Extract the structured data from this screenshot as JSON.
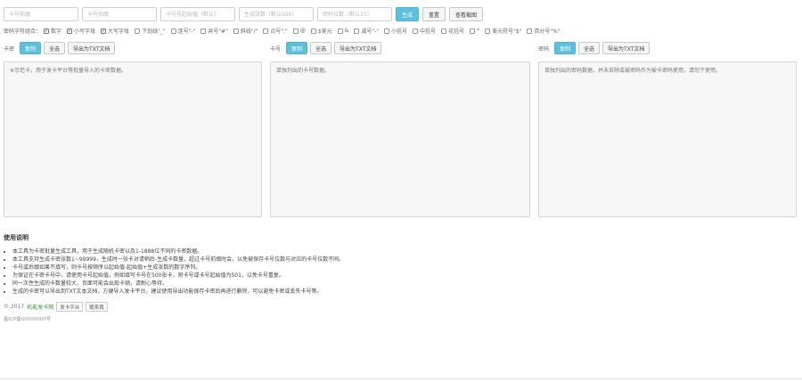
{
  "top": {
    "fields": [
      {
        "placeholder": "卡号前缀"
      },
      {
        "placeholder": "卡号后缀"
      },
      {
        "placeholder": "卡号号起始值（默认）"
      },
      {
        "placeholder": "生成张数（默认500）"
      },
      {
        "placeholder": "密码位数（默认15）"
      }
    ],
    "generate_label": "生成",
    "reset_label": "重置",
    "view_label": "查看截图"
  },
  "charset": {
    "label": "密码字符组合：",
    "options": [
      {
        "label": "数字",
        "checked": true
      },
      {
        "label": "小写字母",
        "checked": true
      },
      {
        "label": "大写字母",
        "checked": true
      },
      {
        "label": "下划线\"_\"",
        "checked": false
      },
      {
        "label": "连号\"-\"",
        "checked": false
      },
      {
        "label": "井号\"#\"",
        "checked": false
      },
      {
        "label": "斜线\"/\"",
        "checked": false
      },
      {
        "label": "点号\".\"",
        "checked": false
      },
      {
        "label": "@",
        "checked": false
      },
      {
        "label": "$美元",
        "checked": false
      },
      {
        "label": "&",
        "checked": false
      },
      {
        "label": "减号\"-\"",
        "checked": false
      },
      {
        "label": "小括号",
        "checked": false
      },
      {
        "label": "中括号",
        "checked": false
      },
      {
        "label": "花括号",
        "checked": false
      },
      {
        "label": "*",
        "checked": false
      },
      {
        "label": "美元符号\"$\"",
        "checked": false
      },
      {
        "label": "百分号\"%\"",
        "checked": false
      }
    ]
  },
  "columns": [
    {
      "title": "卡密",
      "copy": "复制",
      "select_all": "全选",
      "export": "导出为TXT文档",
      "placeholder": "※示范卡，用于发卡平台等批量导入的卡密数据。"
    },
    {
      "title": "卡号",
      "copy": "复制",
      "select_all": "全选",
      "export": "导出为TXT文档",
      "placeholder": "单独列出的卡号数据。"
    },
    {
      "title": "密码",
      "copy": "复制",
      "select_all": "全选",
      "export": "导出为TXT文档",
      "placeholder": "单独列出的密码数据，并未去除或被密码作为被卡密码使用，请勿下使用。"
    }
  ],
  "help": {
    "title": "使用说明",
    "items": [
      "本工具为卡密批量生成工具，用于生成随机卡密以及1-1888位不同的卡密数据。",
      "本工具支持生成卡密张数1~99999，生成时一张卡对请稍后-生成卡数量，超过卡号前缀时会，以免被保存卡号位数与对应的卡号位数不同。",
      "卡号或后缀如果不填写，则卡号按顺序以起始值-起始值+生成张数的数字序列。",
      "为保证在卡密卡号中，请使用卡号起始值，例如填写卡号在500张卡，则卡号或卡号起始值为501，以免卡号重复。",
      "同一次性生成的卡数量较大，页面可能会出现卡顿，请耐心等待。",
      "生成的卡密可以导出到TXT文本文档，方便导入发卡平台，建议使用导出功能保存卡密后再进行删除，可以避免卡密或丢失卡号等。"
    ]
  },
  "footer": {
    "copyright": "© 2017",
    "site_link": "机能发卡网",
    "btn1": "发卡平台",
    "btn2": "联系我",
    "icp": "备ICP备00000000号"
  }
}
